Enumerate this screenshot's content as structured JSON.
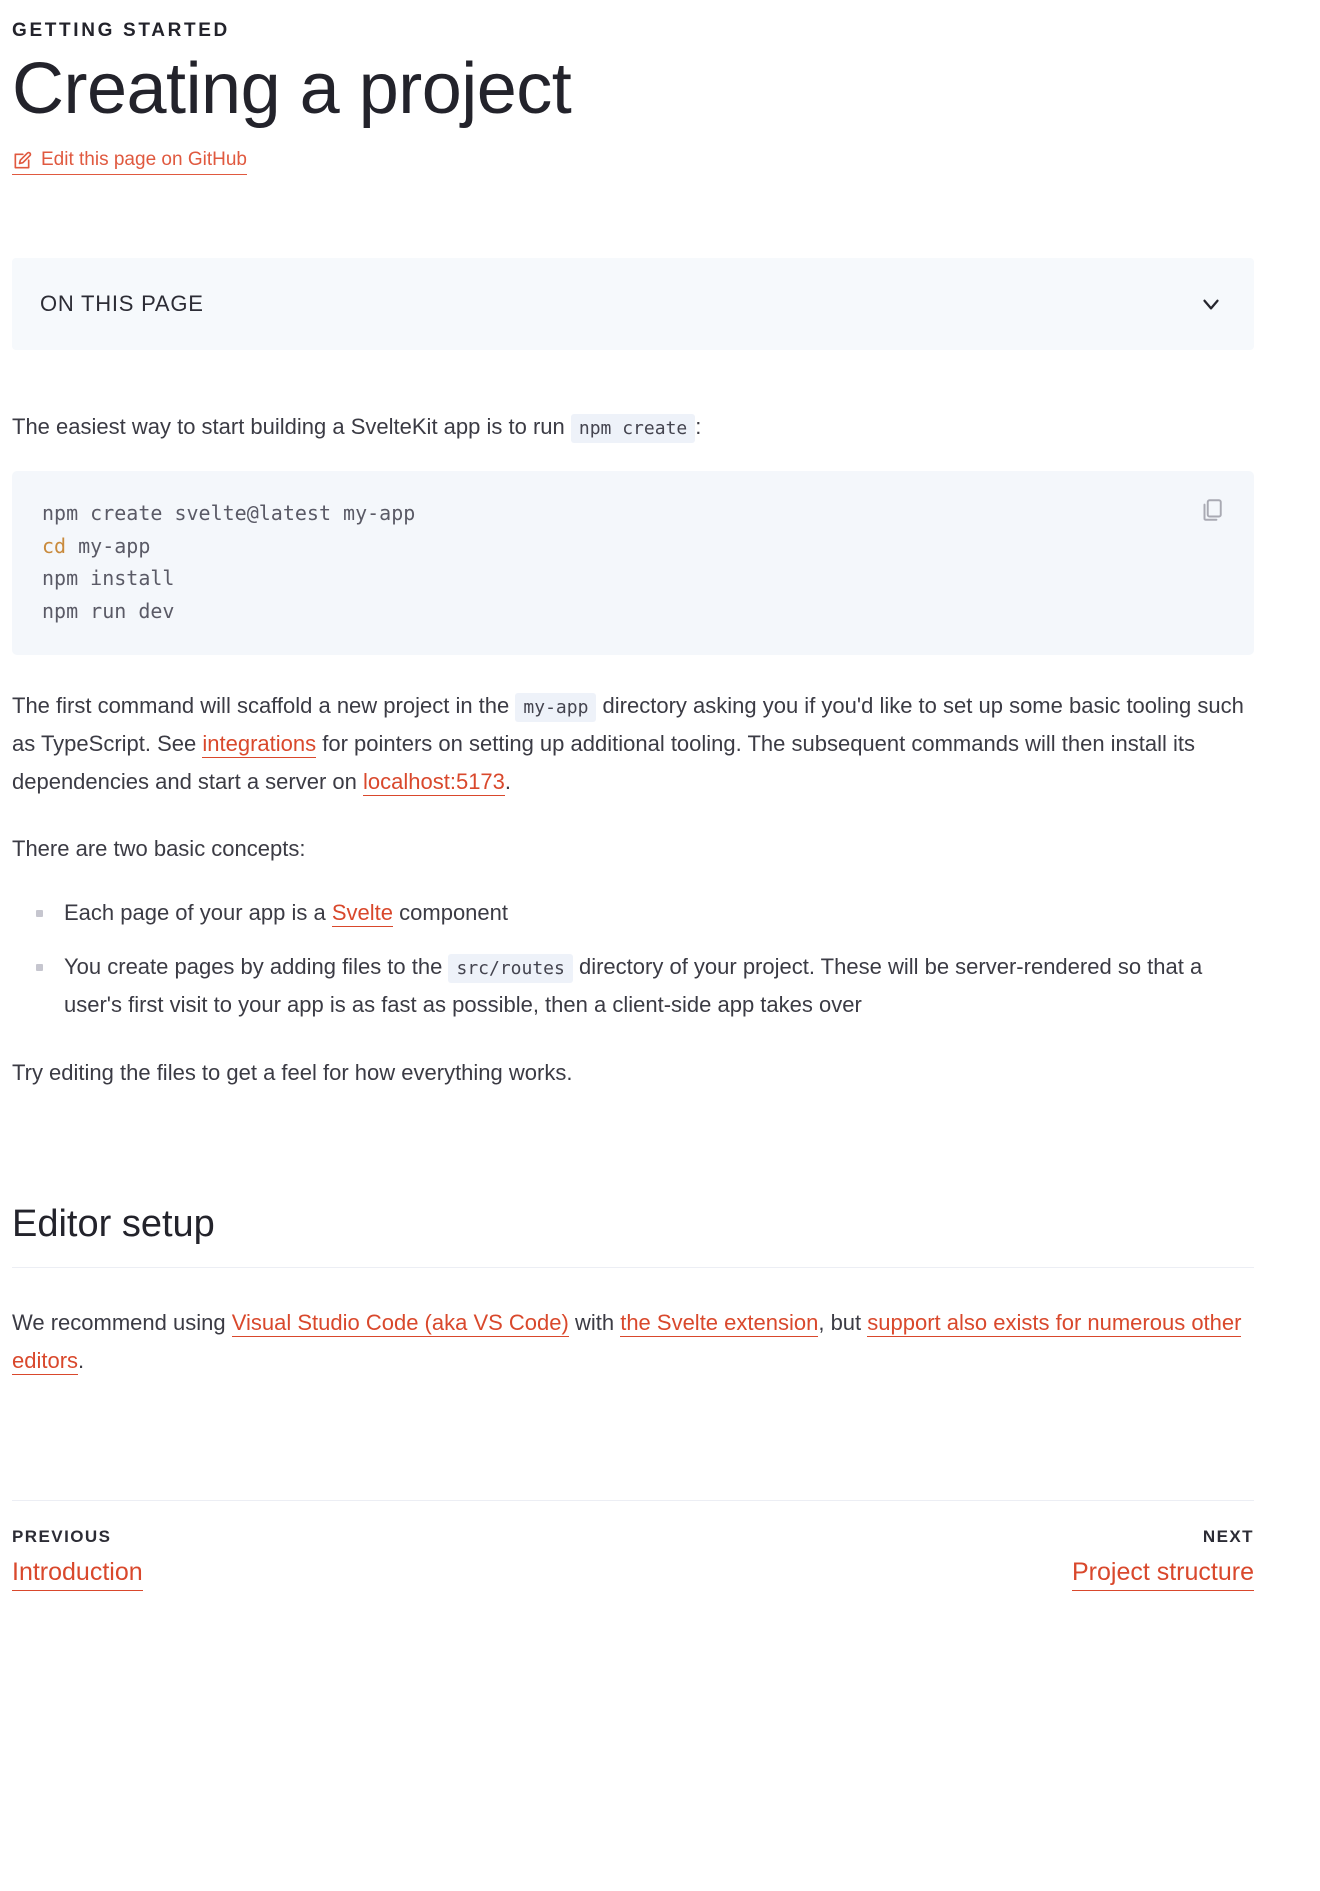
{
  "header": {
    "eyebrow": "GETTING STARTED",
    "title": "Creating a project",
    "edit_link_label": "Edit this page on GitHub",
    "edit_icon": "pencil-square-icon"
  },
  "on_this_page": {
    "label": "ON THIS PAGE",
    "chevron_icon": "chevron-down-icon",
    "expanded": false
  },
  "intro": {
    "text_before": "The easiest way to start building a SvelteKit app is to run",
    "code": "npm create",
    "text_after": ":"
  },
  "code_block": {
    "copy_icon": "copy-icon",
    "lines": [
      {
        "keyword": "",
        "rest": "npm create svelte@latest my-app"
      },
      {
        "keyword": "cd",
        "rest": " my-app"
      },
      {
        "keyword": "",
        "rest": "npm install"
      },
      {
        "keyword": "",
        "rest": "npm run dev"
      }
    ]
  },
  "scaffold_paragraph": {
    "p1": "The first command will scaffold a new project in the",
    "code1": "my-app",
    "p2": "directory asking you if you'd like to set up some basic tooling such as TypeScript. See",
    "link1": "integrations",
    "p3": "for pointers on setting up additional tooling. The subsequent commands will then install its dependencies and start a server on",
    "link2": "localhost:5173",
    "p4": "."
  },
  "concepts": {
    "lead": "There are two basic concepts:",
    "items": [
      {
        "p1": "Each page of your app is a",
        "link": "Svelte",
        "p2": "component"
      },
      {
        "p1": "You create pages by adding files to the",
        "code": "src/routes",
        "p2": "directory of your project. These will be server-rendered so that a user's first visit to your app is as fast as possible, then a client-side app takes over"
      }
    ],
    "closing": "Try editing the files to get a feel for how everything works."
  },
  "editor_setup": {
    "title": "Editor setup",
    "p1": "We recommend using",
    "link1": "Visual Studio Code (aka VS Code)",
    "p2": "with",
    "link2": "the Svelte extension",
    "p3": ", but",
    "link3": "support also exists for numerous other editors",
    "p4": "."
  },
  "page_nav": {
    "previous_kicker": "PREVIOUS",
    "previous_label": "Introduction",
    "next_kicker": "NEXT",
    "next_label": "Project structure"
  },
  "colors": {
    "link": "#d9482c",
    "heading": "#23232b",
    "code_bg": "#f4f7fb",
    "panel_bg": "#f6f9fc"
  }
}
